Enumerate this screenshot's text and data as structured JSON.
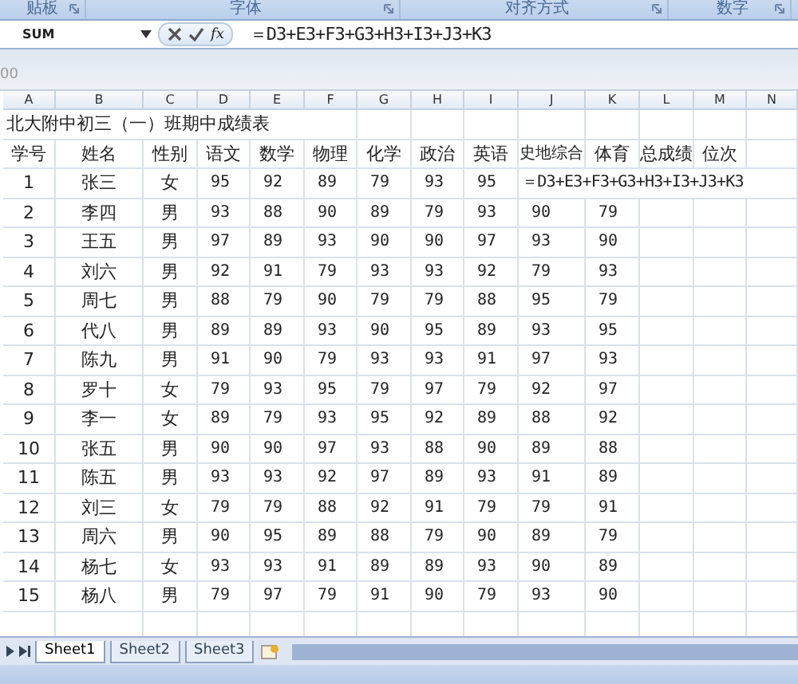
{
  "ribbon_groups": [
    "贴板",
    "字体",
    "对齐方式",
    "数字"
  ],
  "formula_bar": {
    "name_box": "SUM",
    "function_button": "fx",
    "formula": "＝D3+E3+F3+G3+H3+I3+J3+K3"
  },
  "toolbar_strip_text": "00",
  "columns": [
    "A",
    "B",
    "C",
    "D",
    "E",
    "F",
    "G",
    "H",
    "I",
    "J",
    "K",
    "L",
    "M",
    "N"
  ],
  "title": "北大附中初三（一）班期中成绩表",
  "headers": [
    "学号",
    "姓名",
    "性别",
    "语文",
    "数学",
    "物理",
    "化学",
    "政治",
    "英语",
    "史地综合",
    "体育",
    "总成绩",
    "位次"
  ],
  "rows": [
    {
      "cells": [
        "1",
        "张三",
        "女",
        "95",
        "92",
        "89",
        "79",
        "93",
        "95"
      ],
      "overflow": "＝D3+E3+F3+G3+H3+I3+J3+K3"
    },
    {
      "cells": [
        "2",
        "李四",
        "男",
        "93",
        "88",
        "90",
        "89",
        "79",
        "93",
        "90",
        "79"
      ]
    },
    {
      "cells": [
        "3",
        "王五",
        "男",
        "97",
        "89",
        "93",
        "90",
        "90",
        "97",
        "93",
        "90"
      ]
    },
    {
      "cells": [
        "4",
        "刘六",
        "男",
        "92",
        "91",
        "79",
        "93",
        "93",
        "92",
        "79",
        "93"
      ]
    },
    {
      "cells": [
        "5",
        "周七",
        "男",
        "88",
        "79",
        "90",
        "79",
        "79",
        "88",
        "95",
        "79"
      ]
    },
    {
      "cells": [
        "6",
        "代八",
        "男",
        "89",
        "89",
        "93",
        "90",
        "95",
        "89",
        "93",
        "95"
      ]
    },
    {
      "cells": [
        "7",
        "陈九",
        "男",
        "91",
        "90",
        "79",
        "93",
        "93",
        "91",
        "97",
        "93"
      ]
    },
    {
      "cells": [
        "8",
        "罗十",
        "女",
        "79",
        "93",
        "95",
        "79",
        "97",
        "79",
        "92",
        "97"
      ]
    },
    {
      "cells": [
        "9",
        "李一",
        "女",
        "89",
        "79",
        "93",
        "95",
        "92",
        "89",
        "88",
        "92"
      ]
    },
    {
      "cells": [
        "10",
        "张五",
        "男",
        "90",
        "90",
        "97",
        "93",
        "88",
        "90",
        "89",
        "88"
      ]
    },
    {
      "cells": [
        "11",
        "陈五",
        "男",
        "93",
        "93",
        "92",
        "97",
        "89",
        "93",
        "91",
        "89"
      ]
    },
    {
      "cells": [
        "12",
        "刘三",
        "女",
        "79",
        "79",
        "88",
        "92",
        "91",
        "79",
        "79",
        "91"
      ]
    },
    {
      "cells": [
        "13",
        "周六",
        "男",
        "90",
        "95",
        "89",
        "88",
        "79",
        "90",
        "89",
        "79"
      ]
    },
    {
      "cells": [
        "14",
        "杨七",
        "女",
        "93",
        "93",
        "91",
        "89",
        "89",
        "93",
        "90",
        "89"
      ]
    },
    {
      "cells": [
        "15",
        "杨八",
        "男",
        "79",
        "97",
        "79",
        "91",
        "90",
        "79",
        "93",
        "90"
      ]
    }
  ],
  "sheet_tabs": [
    {
      "label": "Sheet1",
      "selected": true
    },
    {
      "label": "Sheet2",
      "selected": false
    },
    {
      "label": "Sheet3",
      "selected": false
    }
  ]
}
